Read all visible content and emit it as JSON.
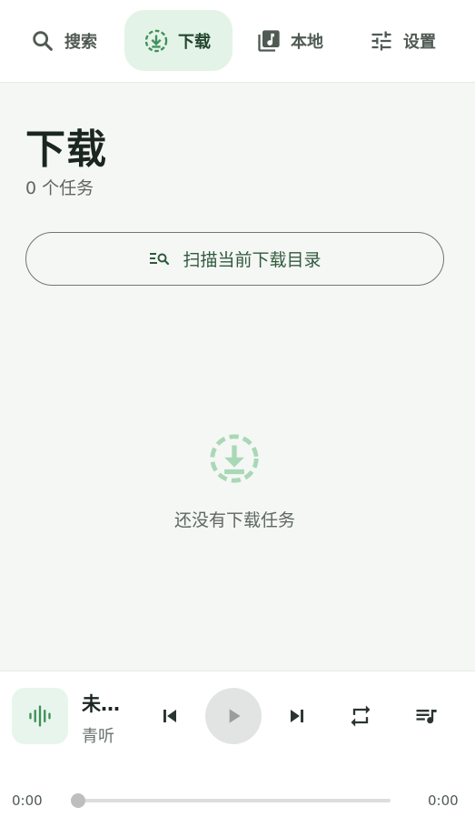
{
  "nav": {
    "search_label": "搜索",
    "download_label": "下载",
    "local_label": "本地",
    "settings_label": "设置",
    "active": "download"
  },
  "download": {
    "title": "下载",
    "task_count": "0 个任务",
    "scan_button_label": "扫描当前下载目录",
    "empty_message": "还没有下载任务"
  },
  "player": {
    "track_title": "未…",
    "artist": "青听",
    "current_time": "0:00",
    "total_time": "0:00",
    "progress_fraction": 0
  },
  "colors": {
    "accent": "#3f8f5a",
    "accent_light": "#a9d8b6",
    "nav_active_bg": "#e3f3e7"
  }
}
